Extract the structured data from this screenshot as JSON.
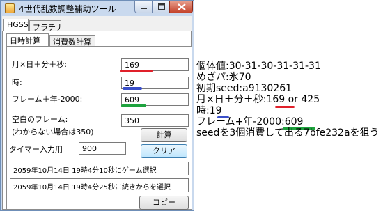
{
  "window": {
    "title": "4世代乱数調整補助ツール"
  },
  "tabs": {
    "top": [
      "HGSS",
      "プラチナ"
    ],
    "sub": [
      "日時計算",
      "消費数計算"
    ]
  },
  "form": {
    "month_day_min_sec": {
      "label": "月×日＋分＋秒:",
      "value": "169"
    },
    "hour": {
      "label": "時:",
      "value": "19"
    },
    "frame_year": {
      "label": "フレーム＋年-2000:",
      "value": "609"
    },
    "empty_frame": {
      "label": "空白のフレーム:",
      "sublabel": "(わからない場合は350)",
      "value": "350"
    },
    "timer": {
      "label": "タイマー入力用",
      "value": "900"
    },
    "calc_button": "計算",
    "clear_button": "クリア",
    "result1": "2059年10月14日 19時4分10秒にゲーム選択",
    "result2": "2059年10月14日 19時4分25秒に続きからを選択",
    "copy_button": "コピー"
  },
  "notes": {
    "line1": "個体値:30-31-30-31-31-31",
    "line2": "めざパ:氷70",
    "line3": "初期seed:a9130261",
    "line4": "月×日＋分＋秒:169 or 425",
    "line5": "時:19",
    "line6": "フレーム+年-2000:609",
    "line7": "seedを3個消費して出る7bfe232aを狙う"
  },
  "colors": {
    "underline_red": "#e0202a",
    "underline_blue": "#3a4fc9",
    "underline_green": "#1ea33e"
  }
}
